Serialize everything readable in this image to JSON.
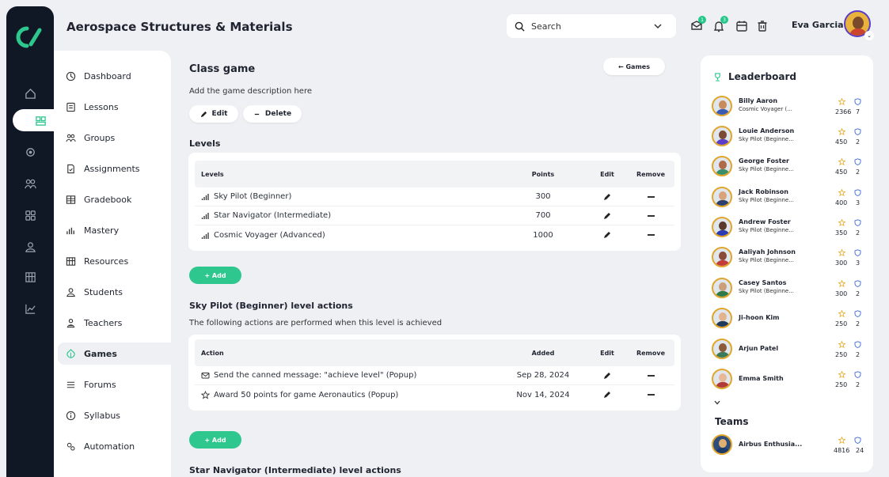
{
  "app": {
    "title": "Aerospace Structures & Materials",
    "search_placeholder": "Search",
    "user_name": "Eva Garcia",
    "notification_badges": [
      "1",
      "3"
    ]
  },
  "sidebar": {
    "items": [
      {
        "label": "Dashboard",
        "icon": "dashboard-icon"
      },
      {
        "label": "Lessons",
        "icon": "lessons-icon"
      },
      {
        "label": "Groups",
        "icon": "groups-icon"
      },
      {
        "label": "Assignments",
        "icon": "assignments-icon"
      },
      {
        "label": "Gradebook",
        "icon": "gradebook-icon"
      },
      {
        "label": "Mastery",
        "icon": "mastery-icon"
      },
      {
        "label": "Resources",
        "icon": "resources-icon"
      },
      {
        "label": "Students",
        "icon": "students-icon"
      },
      {
        "label": "Teachers",
        "icon": "teachers-icon"
      },
      {
        "label": "Games",
        "icon": "games-icon",
        "active": true
      },
      {
        "label": "Forums",
        "icon": "forums-icon"
      },
      {
        "label": "Syllabus",
        "icon": "syllabus-icon"
      },
      {
        "label": "Automation",
        "icon": "automation-icon"
      }
    ]
  },
  "main": {
    "title": "Class game",
    "back_button": "← Games",
    "description": "Add the game description here",
    "edit_button": "Edit",
    "delete_button": "Delete",
    "levels_heading": "Levels",
    "levels_table": {
      "headers": [
        "Levels",
        "Points",
        "Edit",
        "Remove"
      ],
      "rows": [
        {
          "name": "Sky Pilot (Beginner)",
          "points": "300"
        },
        {
          "name": "Star Navigator (Intermediate)",
          "points": "700"
        },
        {
          "name": "Cosmic Voyager (Advanced)",
          "points": "1000"
        }
      ]
    },
    "add_button": "+ Add",
    "level_actions_heading": "Sky Pilot (Beginner) level actions",
    "level_actions_sub": "The following actions are performed when this level is achieved",
    "actions_table": {
      "headers": [
        "Action",
        "Added",
        "Edit",
        "Remove"
      ],
      "rows": [
        {
          "icon": "message-icon",
          "action": "Send the canned message: \"achieve level\" (Popup)",
          "added": "Sep 28, 2024"
        },
        {
          "icon": "star-icon",
          "action": "Award 50 points for game Aeronautics (Popup)",
          "added": "Nov 14, 2024"
        }
      ]
    },
    "next_heading": "Star Navigator (Intermediate) level actions"
  },
  "leaderboard": {
    "title": "Leaderboard",
    "players": [
      {
        "name": "Billy Aaron",
        "level": "Cosmic Voyager (...",
        "points": "2366",
        "rank": "7",
        "skin": "#c98b5a",
        "shirt": "#3b5bb5"
      },
      {
        "name": "Louie Anderson",
        "level": "Sky Pilot (Beginne...",
        "points": "450",
        "rank": "2",
        "skin": "#7a4a36",
        "shirt": "#5a3ec8"
      },
      {
        "name": "George Foster",
        "level": "Sky Pilot (Beginne...",
        "points": "450",
        "rank": "2",
        "skin": "#b06a4a",
        "shirt": "#3a8f6a"
      },
      {
        "name": "Jack Robinson",
        "level": "Sky Pilot (Beginne...",
        "points": "400",
        "rank": "3",
        "skin": "#d9a27b",
        "shirt": "#2d3f6b"
      },
      {
        "name": "Andrew Foster",
        "level": "Sky Pilot (Beginne...",
        "points": "350",
        "rank": "2",
        "skin": "#5a3a2a",
        "shirt": "#2b3bb0"
      },
      {
        "name": "Aaliyah Johnson",
        "level": "Sky Pilot (Beginne...",
        "points": "300",
        "rank": "3",
        "skin": "#8a4a3a",
        "shirt": "#c23c3c"
      },
      {
        "name": "Casey Santos",
        "level": "Sky Pilot (Beginne...",
        "points": "300",
        "rank": "2",
        "skin": "#caa07a",
        "shirt": "#2f7a4a"
      },
      {
        "name": "Ji-hoon Kim",
        "level": "",
        "points": "250",
        "rank": "2",
        "skin": "#e2b48e",
        "shirt": "#1f3a5a"
      },
      {
        "name": "Arjun Patel",
        "level": "",
        "points": "250",
        "rank": "2",
        "skin": "#8a5a3a",
        "shirt": "#3a7a5a"
      },
      {
        "name": "Emma Smith",
        "level": "",
        "points": "250",
        "rank": "2",
        "skin": "#e8b89a",
        "shirt": "#b03a3a"
      }
    ],
    "teams_heading": "Teams",
    "teams": [
      {
        "name": "Airbus Enthusia...",
        "points": "4816",
        "rank": "24"
      }
    ]
  },
  "colors": {
    "accent": "#2ec78d",
    "rail": "#101826",
    "background": "#eef0f3",
    "star": "#e8b23a",
    "rank_icon": "#3a6ad9"
  }
}
